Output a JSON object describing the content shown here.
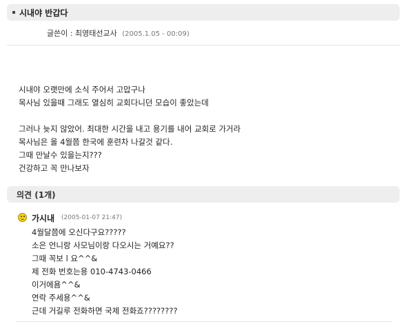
{
  "post": {
    "title": "시내야 반갑다",
    "author_label": "글쓴이 : 최영태선교사",
    "date": "(2005.1.05 - 00:09)",
    "body_lines": [
      "시내야 오랫만에 소식 주어서 고맙구나",
      "목사님 있을때 그래도 열심히 교회다니던 모습이 좋았는데",
      "",
      "그러나 늦지 않았어. 최대한 시간을 내고 용기를 내어 교회로 가거라",
      "목사님은 올 4월쯤 한국에 훈련차 나갈것 같다.",
      "그때 만날수 있을는지???",
      "건강하고 꼭 만나보자"
    ]
  },
  "comments": {
    "header": "의견 (1개)",
    "items": [
      {
        "icon": "smiley-icon",
        "author": "가시내",
        "date": "(2005-01-07  21:47)",
        "lines": [
          "4월달쯤에 오신다구요?????",
          "소은 언니랑 사모님이랑 다오시는 거예요??",
          "그때 꼭보 l 요^^&",
          "제 전화 번호는용 010-4743-0466",
          "이거에욤^^&",
          "연락 주세용^^&",
          "근데 거길루 전화하면 국제 전화죠????????"
        ]
      }
    ]
  },
  "colors": {
    "bar_background": "#eeeeee",
    "smiley": "#f5d21c"
  }
}
